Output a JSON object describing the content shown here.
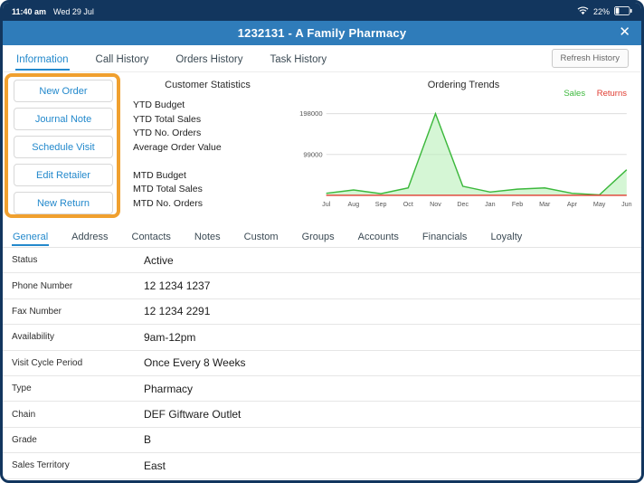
{
  "status_bar": {
    "time": "11:40 am",
    "date": "Wed 29 Jul",
    "battery_percent": "22%"
  },
  "header": {
    "title": "1232131 - A Family Pharmacy",
    "close_icon": "✕"
  },
  "main_tabs": {
    "items": [
      {
        "label": "Information",
        "active": true
      },
      {
        "label": "Call History",
        "active": false
      },
      {
        "label": "Orders History",
        "active": false
      },
      {
        "label": "Task History",
        "active": false
      }
    ],
    "refresh_button": "Refresh History"
  },
  "quick_actions": {
    "buttons": [
      "New Order",
      "Journal Note",
      "Schedule Visit",
      "Edit Retailer",
      "New Return"
    ],
    "highlight_color": "#F0A02F"
  },
  "customer_statistics": {
    "title": "Customer Statistics",
    "rows": [
      "YTD Budget",
      "YTD Total Sales",
      "YTD No. Orders",
      "Average Order Value",
      "",
      "MTD Budget",
      "MTD Total Sales",
      "MTD No. Orders"
    ]
  },
  "chart_data": {
    "type": "area",
    "title": "Ordering Trends",
    "categories": [
      "Jul",
      "Aug",
      "Sep",
      "Oct",
      "Nov",
      "Dec",
      "Jan",
      "Feb",
      "Mar",
      "Apr",
      "May",
      "Jun"
    ],
    "series": [
      {
        "name": "Sales",
        "color": "#3CB83C",
        "fill": "#B9F0B9",
        "values": [
          5000,
          13000,
          4000,
          18000,
          198000,
          22000,
          8000,
          15000,
          18000,
          5000,
          1000,
          62000
        ]
      },
      {
        "name": "Returns",
        "color": "#E03C31",
        "fill": "none",
        "values": [
          0,
          0,
          0,
          0,
          0,
          0,
          0,
          0,
          0,
          0,
          0,
          0
        ]
      }
    ],
    "yticks": [
      99000,
      198000
    ],
    "ylim": [
      0,
      210000
    ],
    "legend_position": "top-right",
    "grid": "horizontal"
  },
  "detail_tabs": {
    "items": [
      {
        "label": "General",
        "active": true
      },
      {
        "label": "Address",
        "active": false
      },
      {
        "label": "Contacts",
        "active": false
      },
      {
        "label": "Notes",
        "active": false
      },
      {
        "label": "Custom",
        "active": false
      },
      {
        "label": "Groups",
        "active": false
      },
      {
        "label": "Accounts",
        "active": false
      },
      {
        "label": "Financials",
        "active": false
      },
      {
        "label": "Loyalty",
        "active": false
      }
    ]
  },
  "details": {
    "rows": [
      {
        "label": "Status",
        "value": "Active"
      },
      {
        "label": "Phone Number",
        "value": "12 1234 1237"
      },
      {
        "label": "Fax Number",
        "value": "12 1234 2291"
      },
      {
        "label": "Availability",
        "value": "9am-12pm"
      },
      {
        "label": "Visit Cycle Period",
        "value": "Once Every 8 Weeks"
      },
      {
        "label": "Type",
        "value": "Pharmacy"
      },
      {
        "label": "Chain",
        "value": "DEF Giftware Outlet"
      },
      {
        "label": "Grade",
        "value": "B"
      },
      {
        "label": "Sales Territory",
        "value": "East"
      }
    ]
  },
  "colors": {
    "accent_blue": "#2389CC",
    "header_blue": "#2F7CBA",
    "status_navy": "#12365E",
    "sales_green": "#3CB83C",
    "returns_red": "#E03C31",
    "highlight_orange": "#F0A02F"
  }
}
